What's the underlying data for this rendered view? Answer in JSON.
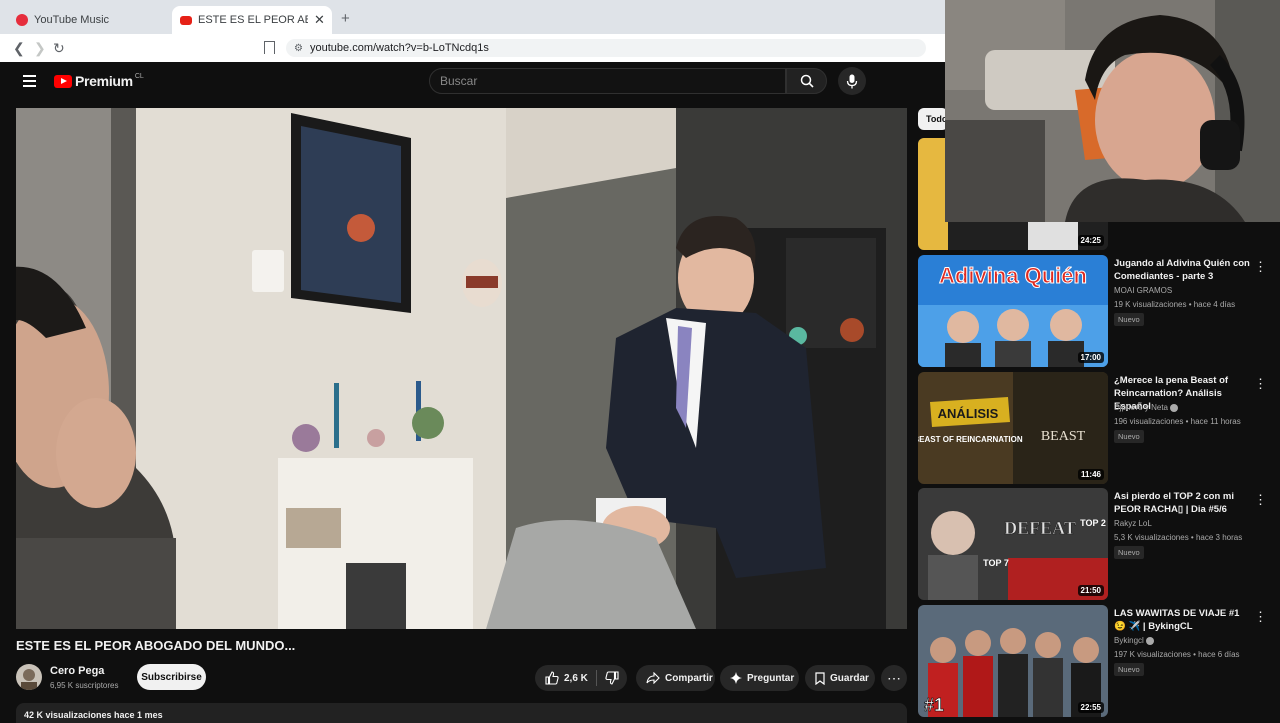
{
  "browser": {
    "tabs": [
      {
        "title": "YouTube Music",
        "active": false
      },
      {
        "title": "ESTE ES EL PEOR ABOGADO DEL",
        "active": true
      }
    ],
    "url": "youtube.com/watch?v=b-LoTNcdq1s",
    "new_tab_symbol": "+",
    "close_symbol": "✕"
  },
  "header": {
    "logo_text": "Premium",
    "country_code": "CL",
    "search_placeholder": "Buscar"
  },
  "video": {
    "title": "ESTE ES EL PEOR ABOGADO DEL MUNDO...",
    "channel": "Cero Pega",
    "subscribers": "6,95 K suscriptores",
    "subscribe_label": "Subscribirse",
    "likes": "2,6 K",
    "share_label": "Compartir",
    "ask_label": "Preguntar",
    "save_label": "Guardar",
    "stats": "42 K visualizaciones  hace 1 mes"
  },
  "sidebar": {
    "chip_label": "Todo",
    "first_duration": "24:25",
    "items": [
      {
        "title": "Jugando al Adivina Quién con Comediantes - parte 3",
        "channel": "MOAI GRAMOS",
        "meta": "19 K visualizaciones • hace 4 días",
        "badge": "Nuevo",
        "duration": "17:00",
        "thumb_text": "Adivina Quién"
      },
      {
        "title": "¿Merece la pena Beast of Reincarnation? Análisis Español",
        "channel": "Djpriето y Neta",
        "meta": "196 visualizaciones • hace 11 horas",
        "badge": "Nuevo",
        "duration": "11:46",
        "thumb_text": "ANÁLISIS",
        "thumb_text2": "BEAST OF REINCARNATION",
        "thumb_text3": "BEAST"
      },
      {
        "title": "Asi pierdo el TOP 2 con mi PEOR RACHA▯ | Dia #5/6",
        "channel": "Rakyz LoL",
        "meta": "5,3 K visualizaciones • hace 3 horas",
        "badge": "Nuevo",
        "duration": "21:50",
        "thumb_text": "DEFEAT",
        "thumb_text2": "TOP 2",
        "thumb_text3": "TOP 7"
      },
      {
        "title": "LAS WAWITAS DE VIAJE #1 😉 ✈️ | BykingCL",
        "channel": "Bykingcl",
        "meta": "197 K visualizaciones • hace 6 días",
        "badge": "Nuevo",
        "duration": "22:55",
        "thumb_text": "#1"
      }
    ]
  }
}
